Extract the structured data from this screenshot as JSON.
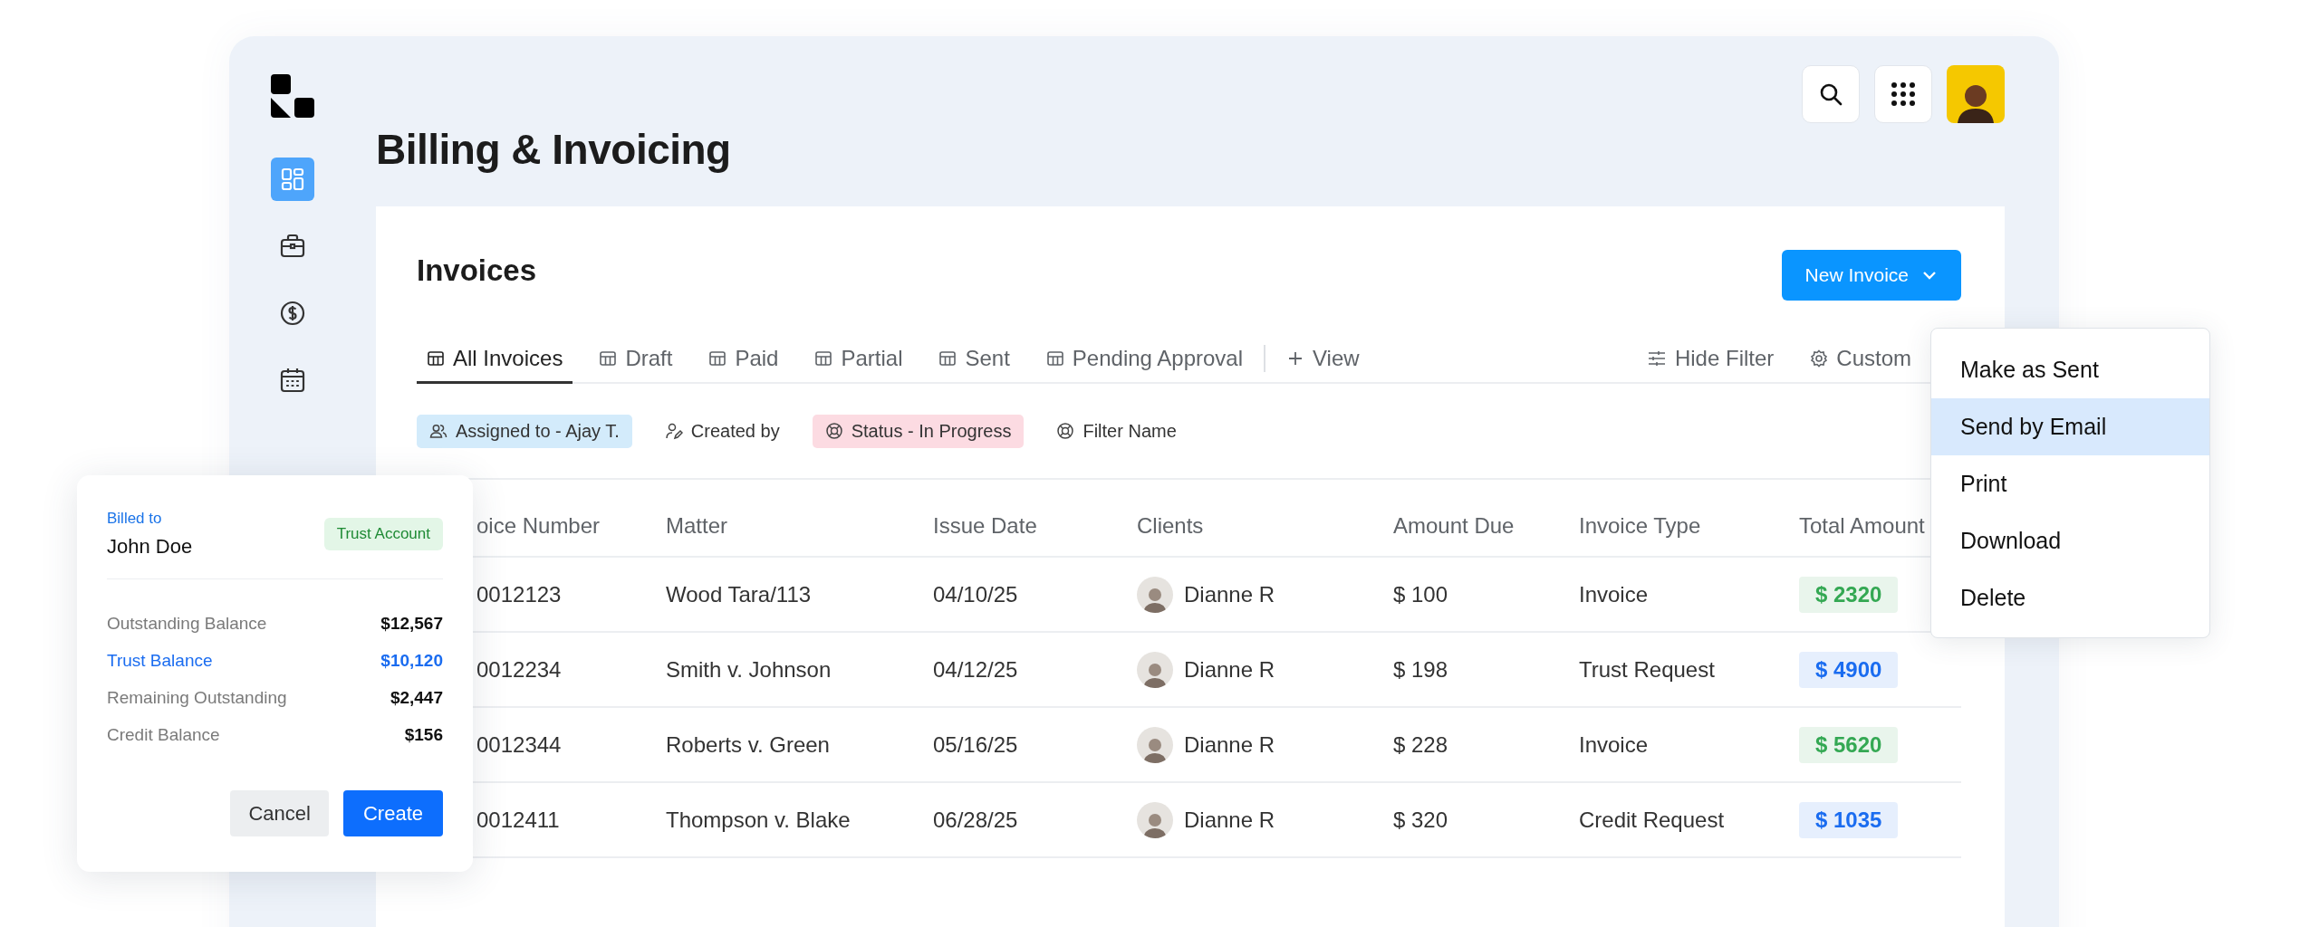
{
  "app": {
    "title": "Billing & Invoicing"
  },
  "sidebar": [
    {
      "kind": "dashboard",
      "selected": true
    },
    {
      "kind": "briefcase",
      "selected": false
    },
    {
      "kind": "dollar",
      "selected": false
    },
    {
      "kind": "calendar",
      "selected": false
    }
  ],
  "panel": {
    "title": "Invoices",
    "new_button": "New Invoice",
    "tabs": [
      {
        "label": "All Invoices",
        "selected": true
      },
      {
        "label": "Draft",
        "selected": false
      },
      {
        "label": "Paid",
        "selected": false
      },
      {
        "label": "Partial",
        "selected": false
      },
      {
        "label": "Sent",
        "selected": false
      },
      {
        "label": "Pending Approval",
        "selected": false
      }
    ],
    "add_view": "View",
    "hide_filter": "Hide Filter",
    "customize": "Custom",
    "filters": [
      {
        "label": "Assigned to - Ajay T.",
        "kind": "users",
        "color": "#d3ebfb"
      },
      {
        "label": "Created by",
        "kind": "person-edit"
      },
      {
        "label": "Status - In Progress",
        "kind": "lifebuoy",
        "color": "#fcdbe2"
      },
      {
        "label": "Filter Name",
        "kind": "lifebuoy"
      }
    ]
  },
  "table": {
    "columns": [
      "oice Number",
      "Matter",
      "Issue Date",
      "Clients",
      "Amount Due",
      "Invoice Type",
      "Total Amount"
    ],
    "rows": [
      {
        "number": "0012123",
        "matter": "Wood Tara/113",
        "date": "04/10/25",
        "client": "Dianne R",
        "due": "$ 100",
        "type": "Invoice",
        "total": "$ 2320",
        "color": "#34a853"
      },
      {
        "number": "0012234",
        "matter": "Smith v. Johnson",
        "date": "04/12/25",
        "client": "Dianne R",
        "due": "$ 198",
        "type": "Trust Request",
        "total": "$ 4900",
        "color": "#1a6cf0"
      },
      {
        "number": "0012344",
        "matter": "Roberts v. Green",
        "date": "05/16/25",
        "client": "Dianne R",
        "due": "$ 228",
        "type": "Invoice",
        "total": "$ 5620",
        "color": "#34a853"
      },
      {
        "number": "0012411",
        "matter": "Thompson v. Blake",
        "date": "06/28/25",
        "client": "Dianne R",
        "due": "$ 320",
        "type": "Credit Request",
        "total": "$ 1035",
        "color": "#1a6cf0"
      }
    ]
  },
  "menu": [
    {
      "label": "Make as Sent",
      "selected": false
    },
    {
      "label": "Send by Email",
      "selected": true
    },
    {
      "label": "Print",
      "selected": false
    },
    {
      "label": "Download",
      "selected": false
    },
    {
      "label": "Delete",
      "selected": false
    }
  ],
  "card": {
    "billed_label": "Billed to",
    "name": "John Doe",
    "badge": "Trust Account",
    "rows": [
      {
        "label": "Outstanding Balance",
        "value": "$12,567",
        "kind": "normal"
      },
      {
        "label": "Trust Balance",
        "value": "$10,120",
        "kind": "highlight"
      },
      {
        "label": "Remaining Outstanding",
        "value": "$2,447",
        "kind": "normal"
      },
      {
        "label": "Credit Balance",
        "value": "$156",
        "kind": "normal"
      }
    ],
    "buttons": [
      "Cancel",
      "Create"
    ]
  }
}
